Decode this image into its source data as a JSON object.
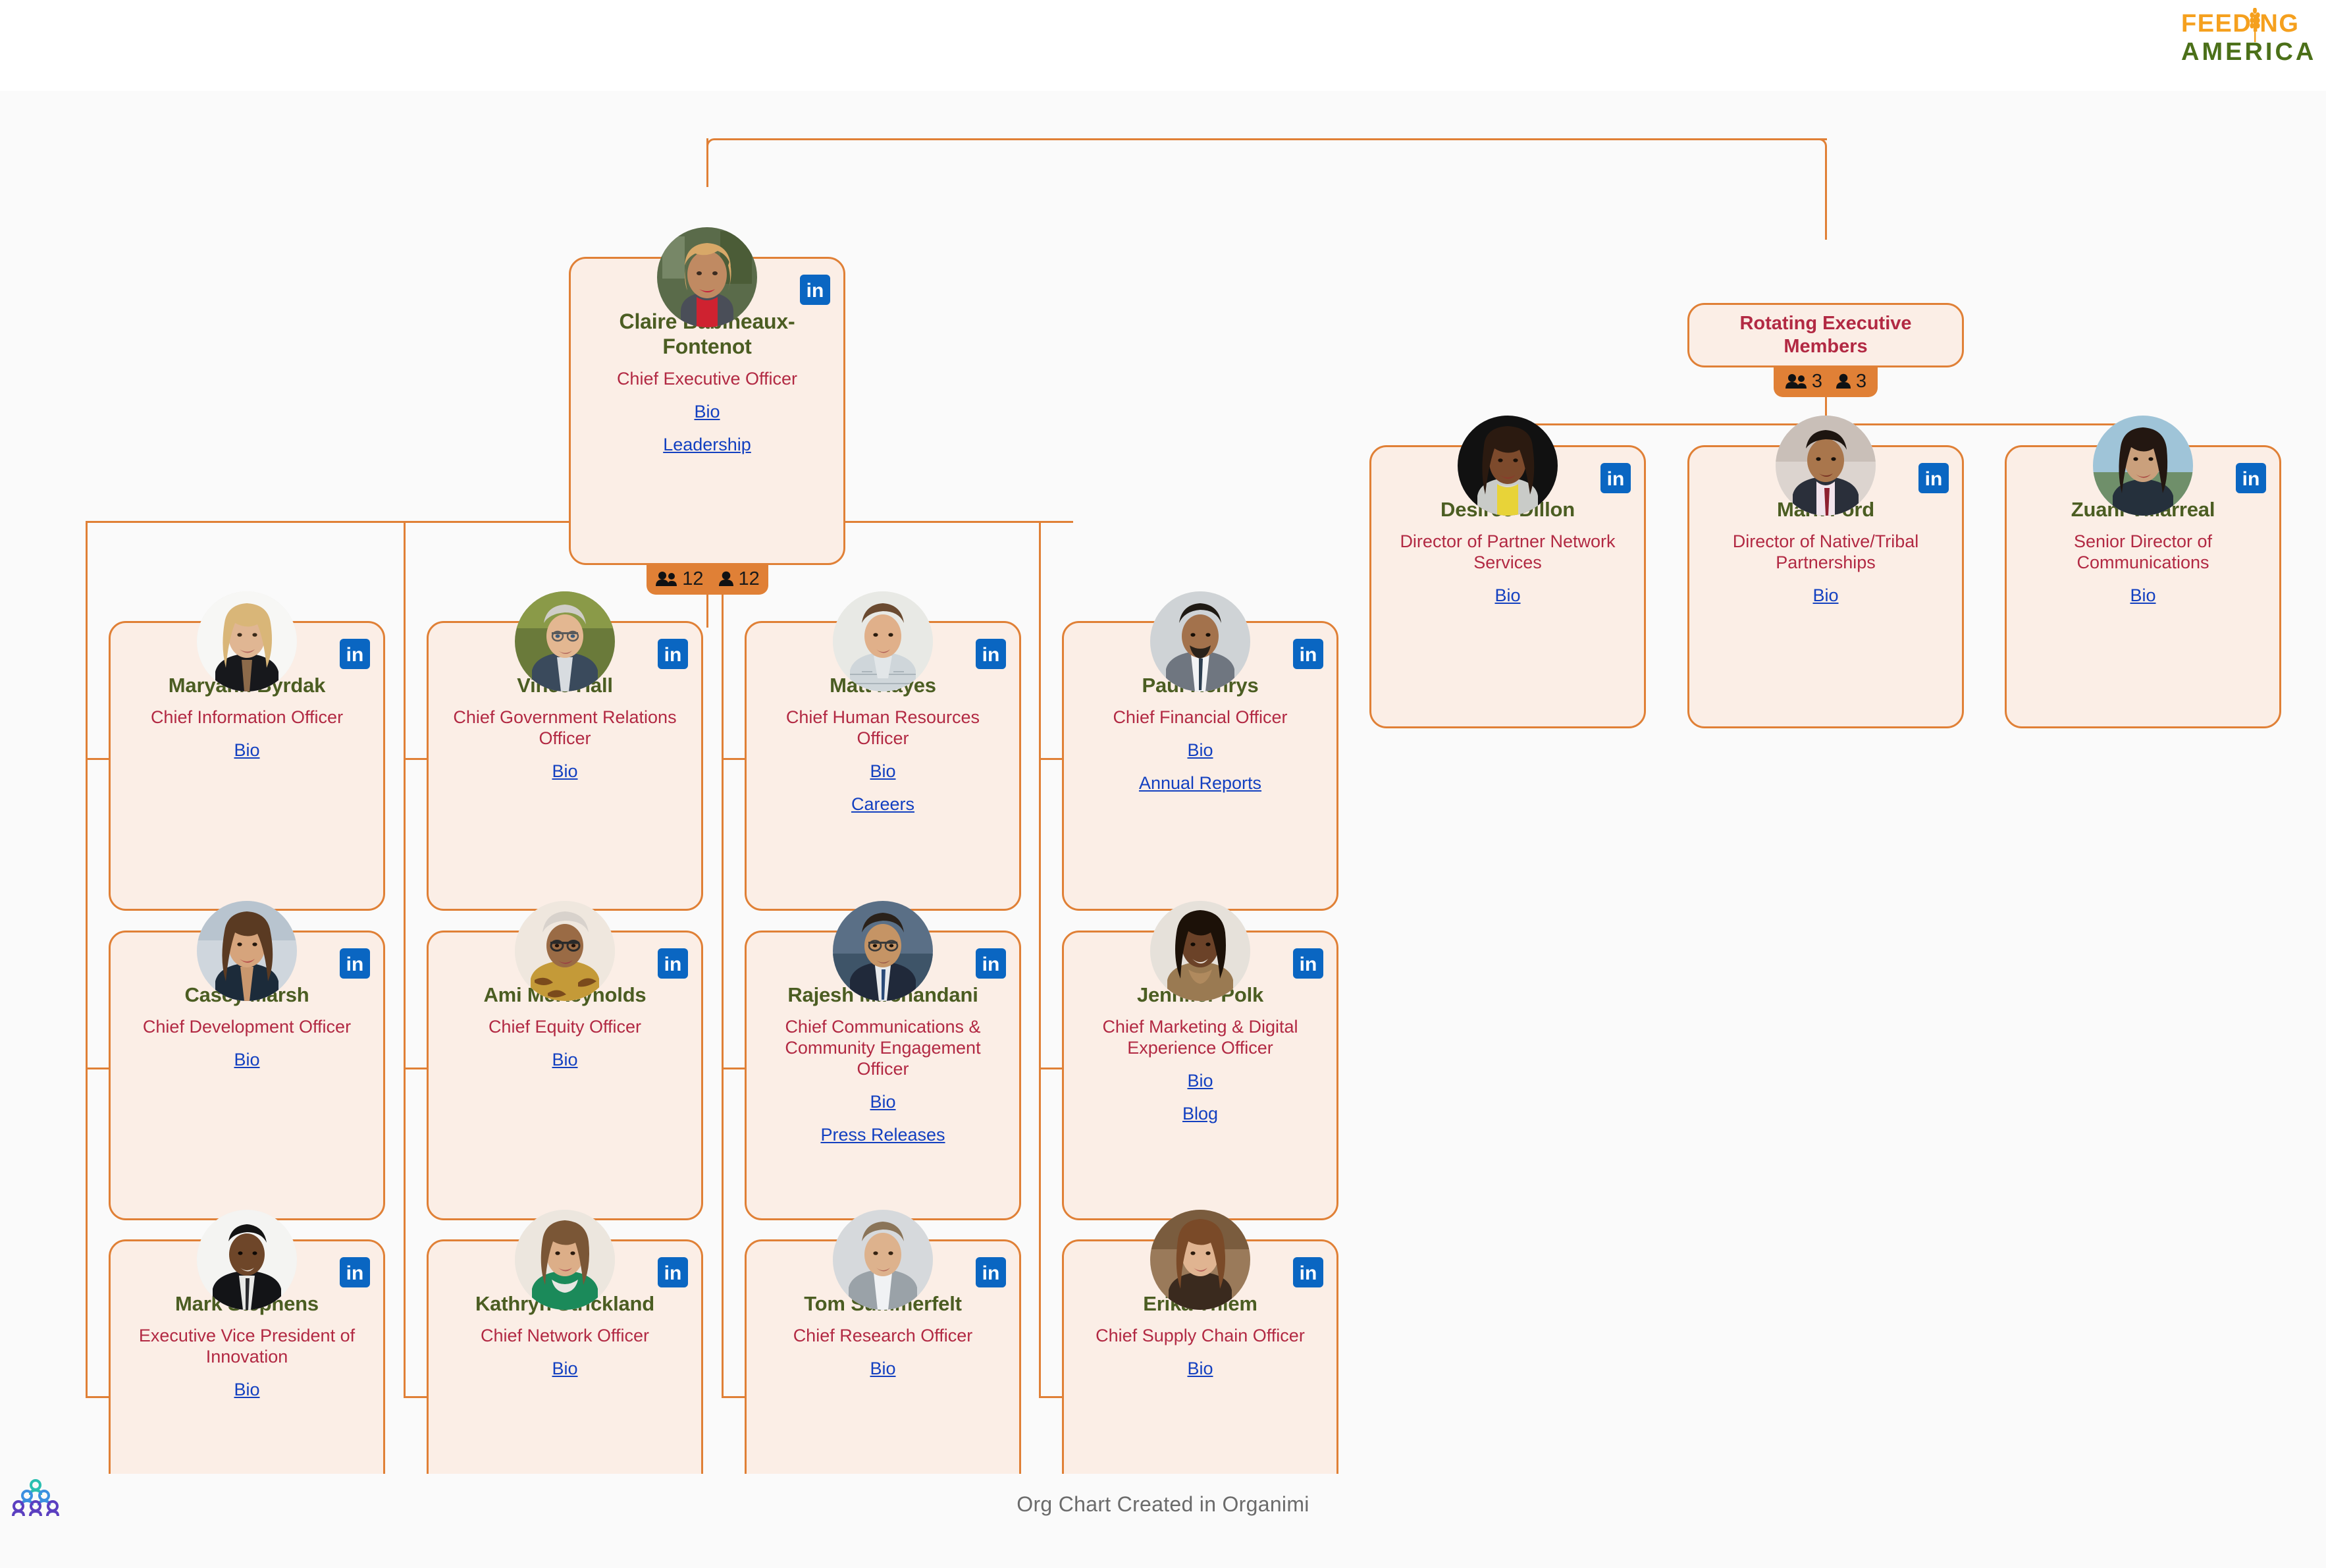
{
  "header": {
    "brand_line1": "FEEDING",
    "brand_line2": "AMERICA",
    "brand_color_primary": "#f5a01e",
    "brand_color_secondary": "#4b7019"
  },
  "theme": {
    "card_background": "#fbeee6",
    "card_border": "#e08036",
    "page_background": "#fafafa",
    "name_color": "#4b5d22",
    "title_color": "#b22943",
    "link_color": "#1340c0",
    "badge_background": "#e08036",
    "linkedin_color": "#0a66c2"
  },
  "icons": {
    "linkedin": "linkedin-icon",
    "group": "group-icon",
    "person": "person-icon",
    "wheat": "wheat-stalk-icon",
    "organimi": "organimi-logo-icon"
  },
  "ceo": {
    "name": "Claire Babineaux-Fontenot",
    "title": "Chief Executive Officer",
    "links": [
      "Bio",
      "Leadership"
    ],
    "linkedin": "in",
    "badge": {
      "group_count": "12",
      "person_count": "12"
    }
  },
  "rotating_group": {
    "title": "Rotating Executive Members",
    "badge": {
      "group_count": "3",
      "person_count": "3"
    }
  },
  "rotating_members": [
    {
      "name": "Desiree Dillon",
      "title": "Director of Partner Network Services",
      "links": [
        "Bio"
      ],
      "linkedin": "in"
    },
    {
      "name": "Mark Ford",
      "title": "Director of Native/Tribal Partnerships",
      "links": [
        "Bio"
      ],
      "linkedin": "in"
    },
    {
      "name": "Zuani Villarreal",
      "title": "Senior Director of Communications",
      "links": [
        "Bio"
      ],
      "linkedin": "in"
    }
  ],
  "executives": [
    {
      "name": "Maryann Byrdak",
      "title": "Chief Information Officer",
      "links": [
        "Bio"
      ],
      "linkedin": "in",
      "column": 1,
      "row": 1
    },
    {
      "name": "Casey Marsh",
      "title": "Chief Development Officer",
      "links": [
        "Bio"
      ],
      "linkedin": "in",
      "column": 1,
      "row": 2
    },
    {
      "name": "Mark Stephens",
      "title": "Executive Vice President of Innovation",
      "links": [
        "Bio"
      ],
      "linkedin": "in",
      "column": 1,
      "row": 3
    },
    {
      "name": "Vince Hall",
      "title": "Chief Government Relations Officer",
      "links": [
        "Bio"
      ],
      "linkedin": "in",
      "column": 2,
      "row": 1
    },
    {
      "name": "Ami McReynolds",
      "title": "Chief Equity Officer",
      "links": [
        "Bio"
      ],
      "linkedin": "in",
      "column": 2,
      "row": 2
    },
    {
      "name": "Kathryn Strickland",
      "title": "Chief Network Officer",
      "links": [
        "Bio"
      ],
      "linkedin": "in",
      "column": 2,
      "row": 3
    },
    {
      "name": "Matt Hayes",
      "title": "Chief Human Resources Officer",
      "links": [
        "Bio",
        "Careers"
      ],
      "linkedin": "in",
      "column": 3,
      "row": 1
    },
    {
      "name": "Rajesh Mirchandani",
      "title": "Chief Communications & Community Engagement Officer",
      "links": [
        "Bio",
        "Press Releases"
      ],
      "linkedin": "in",
      "column": 3,
      "row": 2
    },
    {
      "name": "Tom Summerfelt",
      "title": "Chief Research Officer",
      "links": [
        "Bio"
      ],
      "linkedin": "in",
      "column": 3,
      "row": 3
    },
    {
      "name": "Paul Henrys",
      "title": "Chief Financial Officer",
      "links": [
        "Bio",
        "Annual Reports"
      ],
      "linkedin": "in",
      "column": 4,
      "row": 1
    },
    {
      "name": "Jennifer Polk",
      "title": "Chief Marketing & Digital Experience Officer",
      "links": [
        "Bio",
        "Blog"
      ],
      "linkedin": "in",
      "column": 4,
      "row": 2
    },
    {
      "name": "Erika Thiem",
      "title": "Chief Supply Chain Officer",
      "links": [
        "Bio"
      ],
      "linkedin": "in",
      "column": 4,
      "row": 3
    }
  ],
  "footer": {
    "credit": "Org Chart Created in Organimi"
  }
}
